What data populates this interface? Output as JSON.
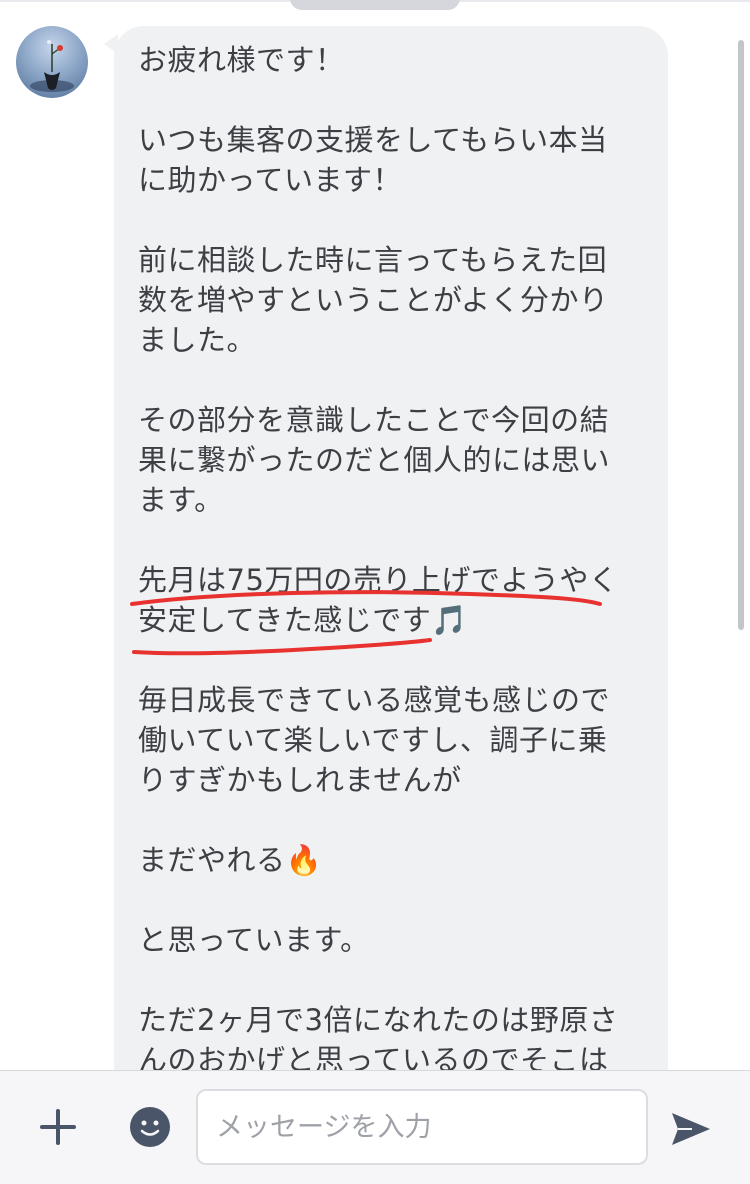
{
  "chat": {
    "message": {
      "lines": [
        "お疲れ様です！",
        "",
        "いつも集客の支援をしてもらい本当",
        "に助かっています！",
        "",
        "前に相談した時に言ってもらえた回",
        "数を増やすということがよく分かり",
        "ました。",
        "",
        "その部分を意識したことで今回の結",
        "果に繋がったのだと個人的には思い",
        "ます。",
        "",
        "先月は75万円の売り上げでようやく",
        "安定してきた感じです🎵",
        "",
        "毎日成長できている感覚も感じので",
        "働いていて楽しいですし、調子に乗",
        "りすぎかもしれませんが",
        "",
        "まだやれる🔥",
        "",
        "と思っています。",
        "",
        "ただ2ヶ月で3倍になれたのは野原さ",
        "んのおかげと思っているのでそこは"
      ]
    },
    "highlight_color": "#e8322f"
  },
  "composer": {
    "placeholder": "メッセージを入力",
    "plus_icon": "plus-icon",
    "emoji_icon": "smiley-icon",
    "send_icon": "send-icon"
  }
}
